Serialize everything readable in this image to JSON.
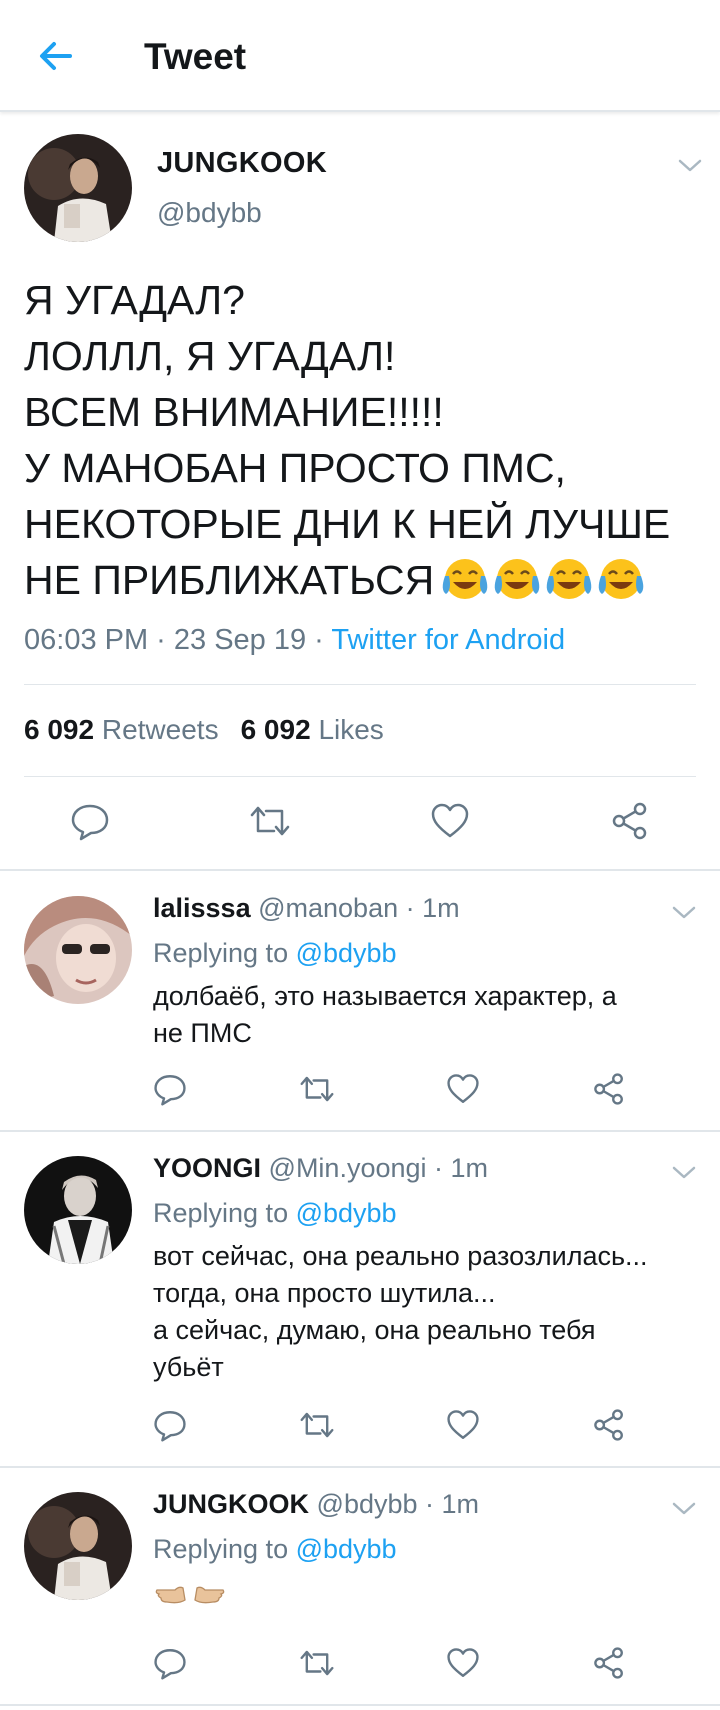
{
  "header": {
    "title": "Tweet"
  },
  "tweet": {
    "name": "JUNGKOOK",
    "handle": "@bdybb",
    "lines": [
      "Я УГАДАЛ?",
      "ЛОЛЛЛ, Я УГАДАЛ!",
      "ВСЕМ ВНИМАНИЕ!!!!!",
      "У МАНОБАН ПРОСТО ПМС,",
      "НЕКОТОРЫЕ ДНИ К НЕЙ ЛУЧШЕ",
      "НЕ ПРИБЛИЖАТЬСЯ"
    ],
    "emoji": "tears-of-joy-emoji x4",
    "meta_time": "06:03 PM · 23 Sep 19 · ",
    "meta_source": "Twitter for Android",
    "retweets_count": "6 092",
    "retweets_label": "Retweets",
    "likes_count": "6 092",
    "likes_label": "Likes"
  },
  "replies": [
    {
      "name": "lalisssa",
      "handle": "@manoban",
      "time": "· 1m",
      "replying_prefix": "Replying to ",
      "replying_to": "@bdybb",
      "lines": [
        "долбаёб, это называется характер, а",
        "не ПМС"
      ]
    },
    {
      "name": "YOONGI",
      "handle": "@Min.yoongi",
      "time": "· 1m",
      "replying_prefix": "Replying to ",
      "replying_to": "@bdybb",
      "lines": [
        "вот сейчас, она реально разозлилась...",
        "тогда, она просто шутила...",
        "а сейчас, думаю, она реально тебя",
        "убьёт"
      ]
    },
    {
      "name": "JUNGKOOK",
      "handle": "@bdybb",
      "time": "· 1m",
      "replying_prefix": "Replying to ",
      "replying_to": "@bdybb",
      "emoji": "pointing-hands-emoji"
    }
  ],
  "colors": {
    "accent": "#1da1f2",
    "secondary_text": "#657786",
    "divider": "#e1e6ea",
    "icon": "#657786"
  }
}
